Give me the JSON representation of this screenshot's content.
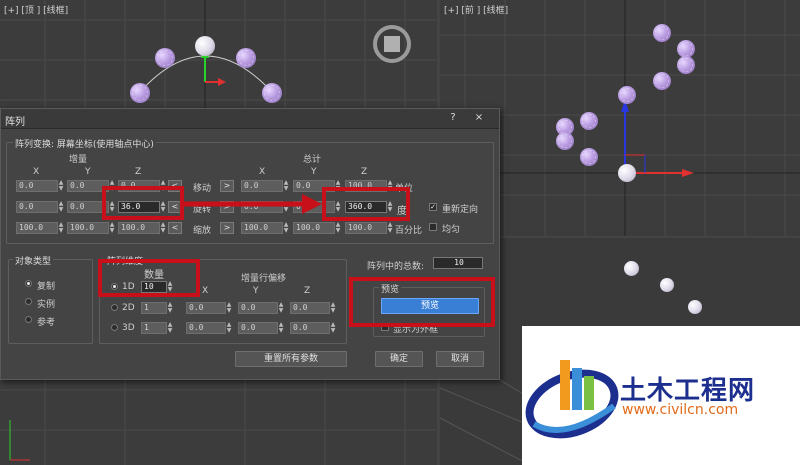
{
  "viewports": {
    "top_label": "[+] [顶 ] [线框]",
    "front_label": "[+] [前 ] [线框]"
  },
  "dialog": {
    "title": "阵列",
    "help_btn": "?",
    "close_btn": "×",
    "transform_group": "阵列变换: 屏幕坐标(使用轴点中心)",
    "increment_label": "增量",
    "total_label": "总计",
    "axis_x": "X",
    "axis_y": "Y",
    "axis_z": "Z",
    "rows": [
      {
        "label": "移动",
        "inc": [
          "0.0",
          "0.0",
          "0.0"
        ],
        "tot": [
          "0.0",
          "0.0",
          "100.0"
        ],
        "unit": "单位"
      },
      {
        "label": "旋转",
        "inc": [
          "0.0",
          "0.0",
          "36.0"
        ],
        "tot": [
          "0.0",
          "0.0",
          "360.0"
        ],
        "unit": "度"
      },
      {
        "label": "缩放",
        "inc": [
          "100.0",
          "100.0",
          "100.0"
        ],
        "tot": [
          "100.0",
          "100.0",
          "100.0"
        ],
        "unit": "百分比"
      }
    ],
    "left_arrow": "<",
    "right_arrow": ">",
    "reorient_label": "重新定向",
    "uniform_label": "均匀",
    "object_type_group": "对象类型",
    "object_types": [
      "复制",
      "实例",
      "参考"
    ],
    "dimensions_group": "阵列维度",
    "count_label": "数量",
    "offset_label": "增量行偏移",
    "dims": [
      {
        "label": "1D",
        "count": "10"
      },
      {
        "label": "2D",
        "count": "1",
        "offsets": [
          "0.0",
          "0.0",
          "0.0"
        ]
      },
      {
        "label": "3D",
        "count": "1",
        "offsets": [
          "0.0",
          "0.0",
          "0.0"
        ]
      }
    ],
    "total_in_array_label": "阵列中的总数:",
    "total_in_array_value": "10",
    "preview_group": "预览",
    "preview_button": "预览",
    "show_as_box": "显示为外框",
    "reset_button": "重置所有参数",
    "ok_button": "确定",
    "cancel_button": "取消"
  },
  "watermark": {
    "name": "土木工程网",
    "url": "www.civilcn.com"
  },
  "colors": {
    "highlight_red": "#c8101a",
    "preview_blue": "#3a7fd6",
    "viewport_bg": "#3c3c3c"
  }
}
